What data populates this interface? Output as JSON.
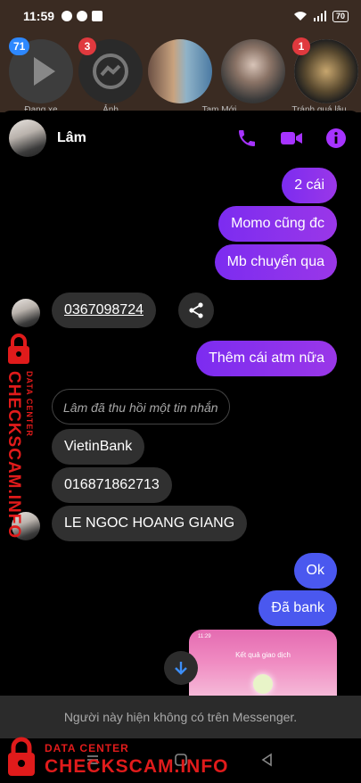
{
  "status_bar": {
    "time": "11:59",
    "battery": "70"
  },
  "stories": [
    {
      "badge": "71",
      "label": "Đang xe",
      "badge_color": "#2d88ff"
    },
    {
      "badge": "3",
      "label": "Ảnh",
      "badge_color": "#e0393e"
    },
    {
      "badge": "",
      "label": "Tam Mới",
      "badge_color": ""
    },
    {
      "badge": "",
      "label": "",
      "badge_color": ""
    },
    {
      "badge": "1",
      "label": "Tránh quá lâu",
      "badge_color": "#e0393e"
    }
  ],
  "chat": {
    "contact_name": "Lâm",
    "messages_out_1": [
      "2 cái",
      "Momo cũng đc",
      "Mb chuyển qua"
    ],
    "phone_msg": "0367098724",
    "msg_out_atm": "Thêm cái atm nữa",
    "recalled_notice": "Lâm đã thu hồi một tin nhắn",
    "messages_in": [
      "VietinBank",
      "016871862713",
      "LE NGOC HOANG GIANG"
    ],
    "messages_out_2": [
      "Ok",
      "Đã bank"
    ],
    "image_title": "Kết quả giao dịch",
    "image_time": "11:29"
  },
  "notice": "Người này hiện không có trên Messenger.",
  "watermark": {
    "brand": "CHECKSCAM.INFO",
    "subtitle": "DATA CENTER"
  },
  "colors": {
    "accent_purple": "#9a37e8",
    "outgoing_blue": "#4a58ef",
    "icon_purple": "#a633ff",
    "watermark_red": "#e01b1b"
  }
}
